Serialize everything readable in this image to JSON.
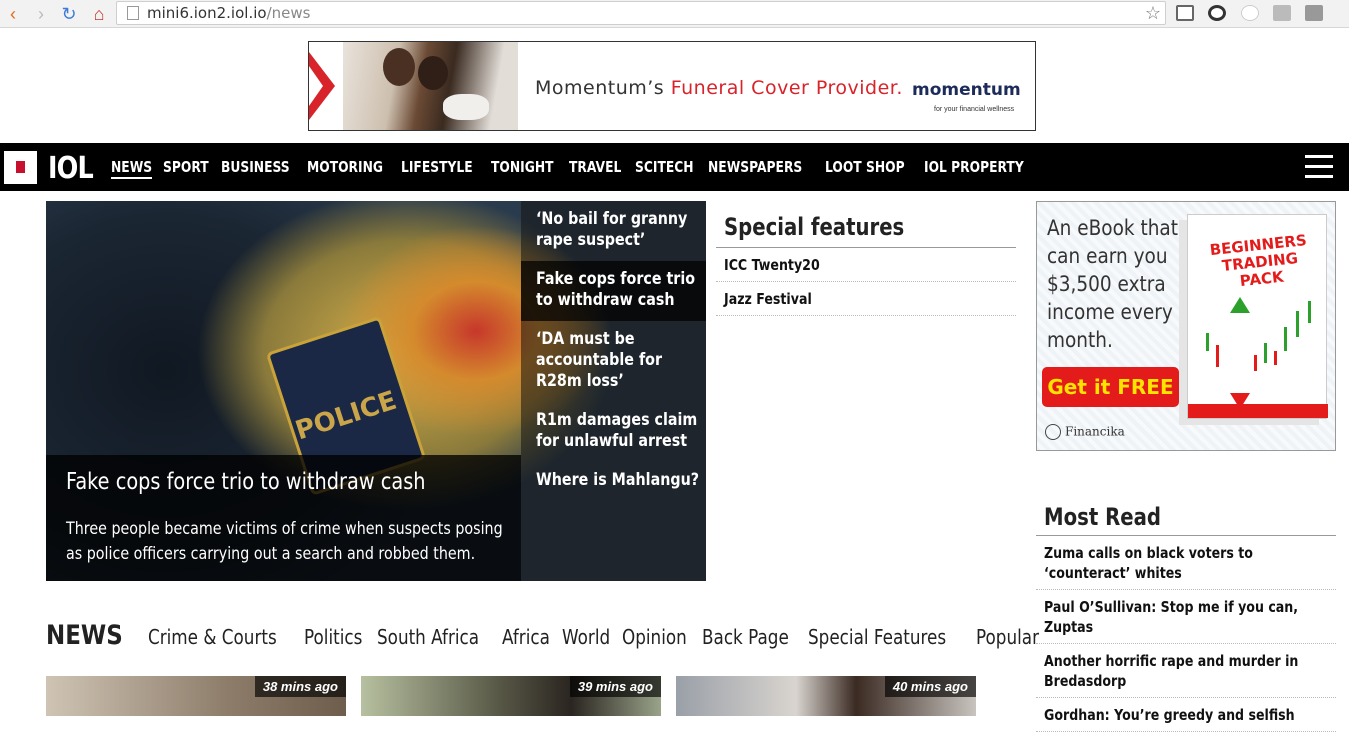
{
  "browser": {
    "url_host": "mini6.ion2.iol.io",
    "url_path": "/news"
  },
  "top_ad": {
    "brand_lead": "Momentum’s ",
    "headline": "Funeral Cover Provider.",
    "logo": "momentum",
    "tagline": "for your financial wellness"
  },
  "nav": {
    "logo": "IOL",
    "items": [
      "NEWS",
      "SPORT",
      "BUSINESS",
      "MOTORING",
      "LIFESTYLE",
      "TONIGHT",
      "TRAVEL",
      "SCITECH",
      "NEWSPAPERS",
      "LOOT SHOP",
      "IOL PROPERTY"
    ]
  },
  "hero": {
    "image_text": "POLICE",
    "title": "Fake cops force trio to withdraw cash",
    "desc": "Three people became victims of crime when suspects posing as police officers carrying out a search and robbed them.",
    "side": [
      "‘No bail for granny rape suspect’",
      "Fake cops force trio to withdraw cash",
      "‘DA must be accountable for R28m loss’",
      "R1m damages claim for unlawful arrest",
      "Where is Mahlangu?"
    ]
  },
  "special": {
    "title": "Special features",
    "items": [
      "ICC Twenty20",
      "Jazz Festival"
    ]
  },
  "side_ad": {
    "lines": [
      "An eBook that",
      "can earn you",
      "$3,500 extra",
      "income every",
      "month."
    ],
    "cta": "Get it FREE",
    "book_title": "BEGINNERS TRADING PACK",
    "brand": "Financika"
  },
  "most_read": {
    "title": "Most Read",
    "items": [
      "Zuma calls on black voters to ‘counteract’ whites",
      "Paul O’Sullivan: Stop me if you can, Zuptas",
      "Another horrific rape and murder in Bredasdorp",
      "Gordhan: You’re greedy and selfish"
    ]
  },
  "news_section": {
    "title": "NEWS",
    "tabs": [
      "Crime & Courts",
      "Politics",
      "South Africa",
      "Africa",
      "World",
      "Opinion",
      "Back Page",
      "Special Features",
      "Popular"
    ]
  },
  "thumbs": [
    {
      "time": "38 mins ago"
    },
    {
      "time": "39 mins ago"
    },
    {
      "time": "40 mins ago"
    }
  ],
  "colors": {
    "brand_red": "#c8102e",
    "nav_bg": "#000000",
    "ad_red": "#d8232a"
  }
}
